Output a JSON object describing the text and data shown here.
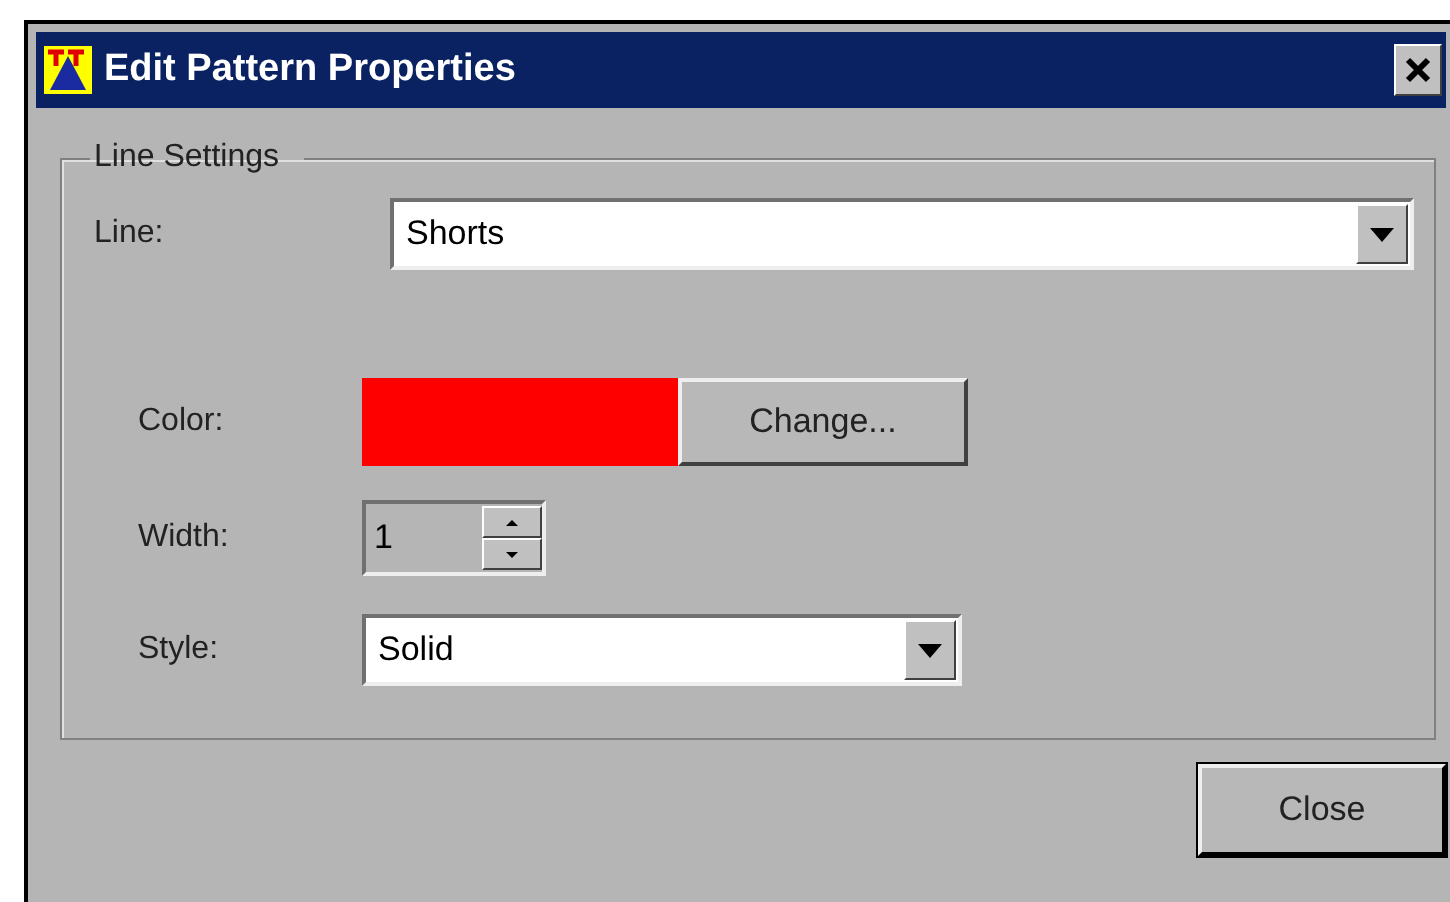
{
  "window": {
    "title": "Edit Pattern Properties"
  },
  "group": {
    "title": "Line Settings"
  },
  "line": {
    "label": "Line:",
    "value": "Shorts"
  },
  "color": {
    "label": "Color:",
    "color": "#ff0000",
    "button": "Change..."
  },
  "width": {
    "label": "Width:",
    "value": "1",
    "disabled": true
  },
  "style": {
    "label": "Style:",
    "value": "Solid"
  },
  "buttons": [
    "Close"
  ]
}
